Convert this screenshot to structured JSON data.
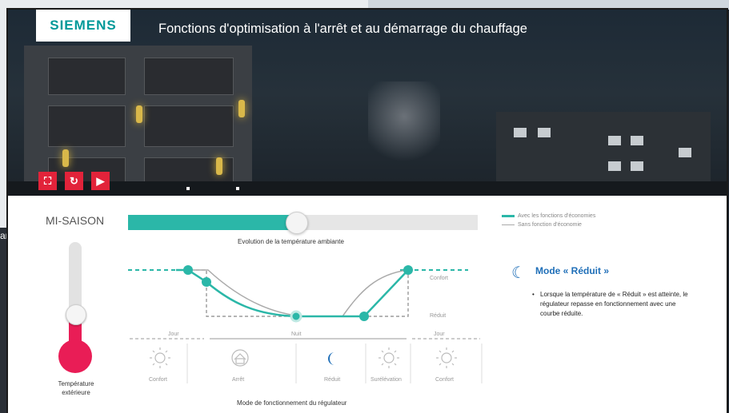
{
  "background": {
    "partial_text_left": "ar"
  },
  "banner": {
    "brand": "SIEMENS",
    "title": "Fonctions d'optimisation à l'arrêt et au démarrage du chauffage",
    "controls": {
      "fullscreen": "⛶",
      "replay": "↻",
      "play": "▶"
    }
  },
  "season": {
    "label": "MI-SAISON"
  },
  "thermometer": {
    "label_line1": "Température",
    "label_line2": "extérieure",
    "level": 0.4
  },
  "progress": {
    "value": 0.48
  },
  "chart_labels": {
    "evolution": "Evolution de la température ambiante",
    "confort_level": "Confort",
    "reduit_level": "Réduit",
    "jour_left": "Jour",
    "nuit": "Nuit",
    "jour_right": "Jour",
    "modes": [
      "Confort",
      "Arrêt",
      "Réduit",
      "Surélévation",
      "Confort"
    ],
    "bottom": "Mode de fonctionnement du régulateur"
  },
  "legend": {
    "with": "Avec les fonctions d'économies",
    "without": "Sans fonction d'économie"
  },
  "mode": {
    "title": "Mode « Réduit »",
    "description": "Lorsque la température de « Réduit » est atteinte, le régulateur repasse en fonctionnement avec une courbe réduite."
  },
  "colors": {
    "accent": "#2bb7a8",
    "grey_curve": "#aaaaaa",
    "brand": "#009999",
    "red": "#e2233a",
    "mode_blue": "#1f6fb8"
  }
}
